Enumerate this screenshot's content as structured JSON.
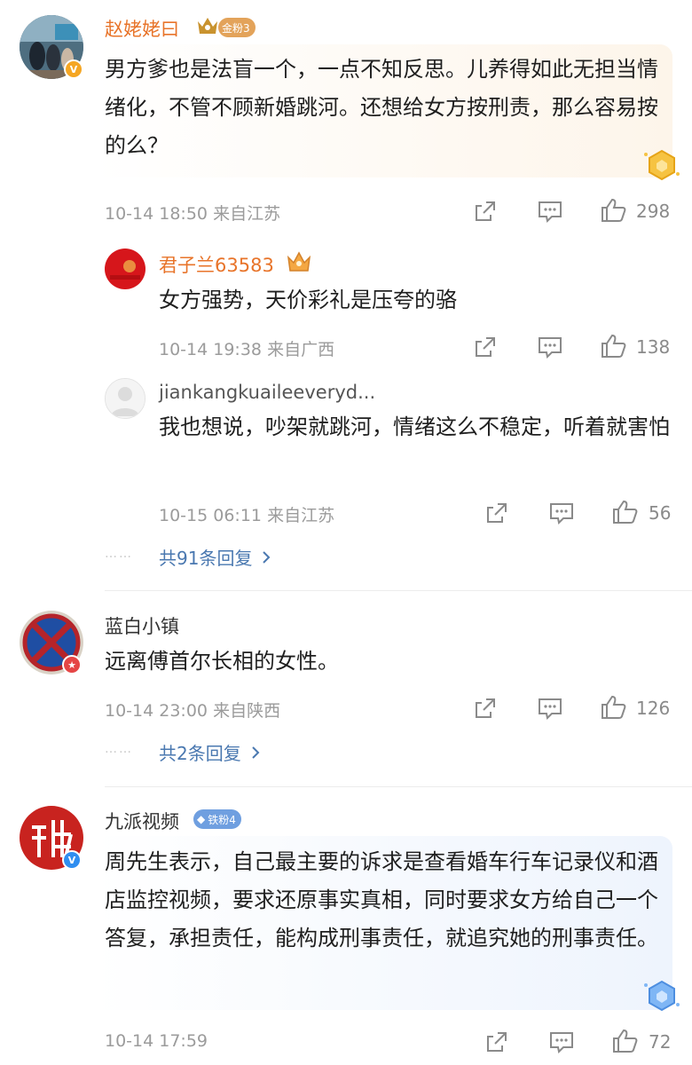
{
  "comments": [
    {
      "username": "赵姥姥曰",
      "fan_badge": "金粉3",
      "content": "男方爹也是法盲一个，一点不知反思。儿养得如此无担当情绪化，不管不顾新婚跳河。还想给女方按刑责，那么容易按的么？",
      "time": "10-14 18:50",
      "location": "来自江苏",
      "likes": "298",
      "replies": [
        {
          "username": "君子兰63583",
          "content": "女方强势，天价彩礼是压夸的骆",
          "time": "10-14 19:38",
          "location": "来自广西",
          "likes": "138"
        },
        {
          "username": "jiankangkuaileeveryd...",
          "content": "我也想说，吵架就跳河，情绪这么不稳定，听着就害怕",
          "time": "10-15 06:11",
          "location": "来自江苏",
          "likes": "56"
        }
      ],
      "more_replies": "共91条回复",
      "dots": "……"
    },
    {
      "username": "蓝白小镇",
      "content": "远离傅首尔长相的女性。",
      "time": "10-14 23:00",
      "location": "来自陕西",
      "likes": "126",
      "more_replies": "共2条回复",
      "dots": "……"
    },
    {
      "username": "九派视频",
      "fan_badge": "铁粉4",
      "content": "周先生表示，自己最主要的诉求是查看婚车行车记录仪和酒店监控视频，要求还原事实真相，同时要求女方给自己一个答复，承担责任，能构成刑事责任，就追究她的刑事责任。",
      "time": "10-14 17:59",
      "likes": "72"
    }
  ],
  "colors": {
    "username_orange": "#e8742a",
    "link_blue": "#4a78b0",
    "meta_gray": "#9b9b9b",
    "gold_bubble": "#fdf6ec",
    "blue_bubble": "#eef4fd"
  }
}
